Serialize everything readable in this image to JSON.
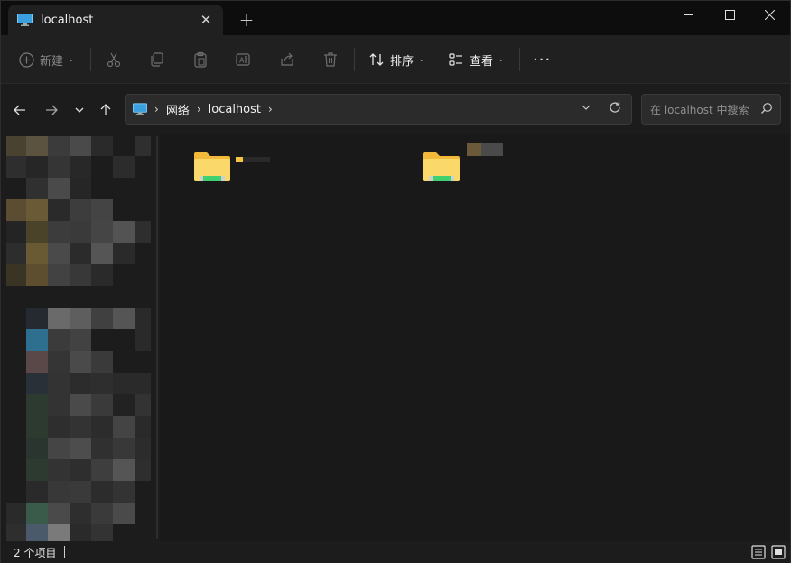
{
  "window": {
    "tab_title": "localhost",
    "new_tab_symbol": "+",
    "close_tab_symbol": "✕"
  },
  "commands": {
    "new_label": "新建",
    "sort_label": "排序",
    "view_label": "查看",
    "more_symbol": "···"
  },
  "address": {
    "crumbs": [
      "网络",
      "localhost"
    ],
    "search_placeholder": "在 localhost 中搜索"
  },
  "status": {
    "item_count": "2 个项目"
  },
  "colors": {
    "accent_folder": "#f6c445",
    "drive_green": "#3fd16f",
    "computer_icon": "#3aa0e0"
  },
  "icons": [
    "computer-icon",
    "cut-icon",
    "copy-icon",
    "paste-icon",
    "rename-icon",
    "share-icon",
    "delete-icon",
    "sort-icon",
    "view-icon",
    "more-icon",
    "back-icon",
    "forward-icon",
    "recent-icon",
    "up-icon",
    "refresh-icon",
    "search-icon",
    "details-view-icon",
    "tiles-view-icon"
  ]
}
